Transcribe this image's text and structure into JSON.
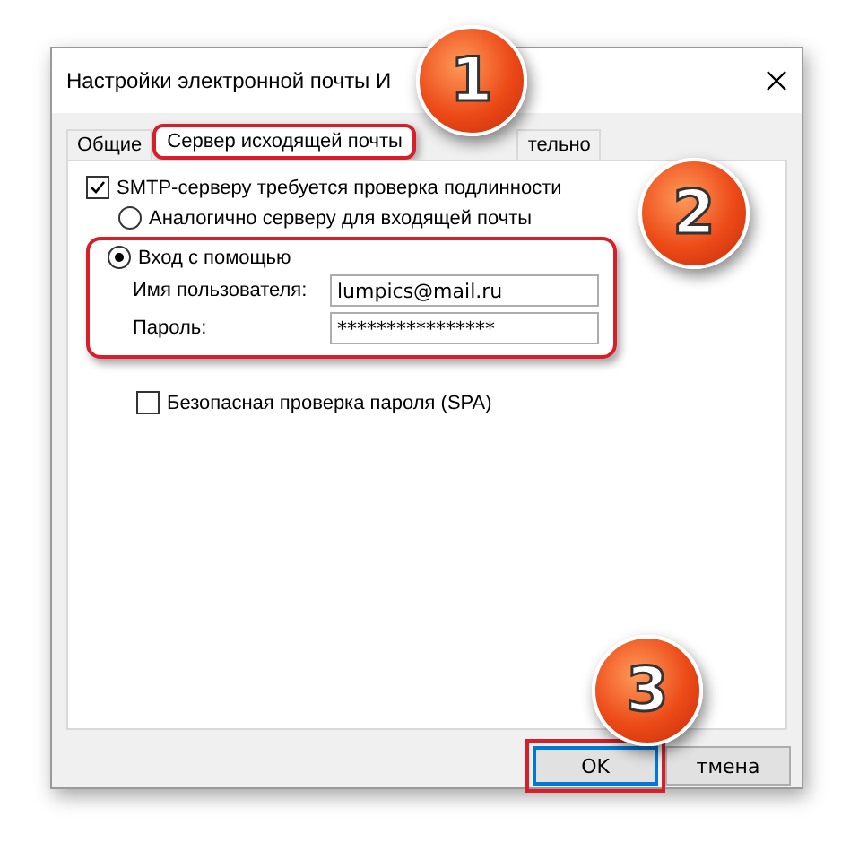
{
  "window": {
    "title": "Настройки электронной почты И"
  },
  "tabs": [
    {
      "label": "Общие",
      "selected": false,
      "highlighted": false
    },
    {
      "label": "Сервер исходящей почты",
      "selected": true,
      "highlighted": true
    },
    {
      "label": "тельно",
      "selected": false,
      "highlighted": false
    }
  ],
  "smtp_auth": {
    "label": "SMTP-серверу требуется проверка подлинности",
    "checked": true
  },
  "auth_options": [
    {
      "label": "Аналогично серверу для входящей почты",
      "selected": false
    },
    {
      "label": "Вход с помощью",
      "selected": true
    }
  ],
  "login_highlighted": true,
  "fields": [
    {
      "label": "Имя пользователя:",
      "value": "lumpics@mail.ru"
    },
    {
      "label": "Пароль:",
      "value": "****************"
    }
  ],
  "spa": {
    "label": "Безопасная проверка пароля (SPA)",
    "checked": false
  },
  "buttons": [
    {
      "label": "OK",
      "default": true,
      "highlighted": true
    },
    {
      "label": "тмена",
      "default": false,
      "highlighted": false
    }
  ],
  "callouts": [
    {
      "number": "1"
    },
    {
      "number": "2"
    },
    {
      "number": "3"
    }
  ]
}
